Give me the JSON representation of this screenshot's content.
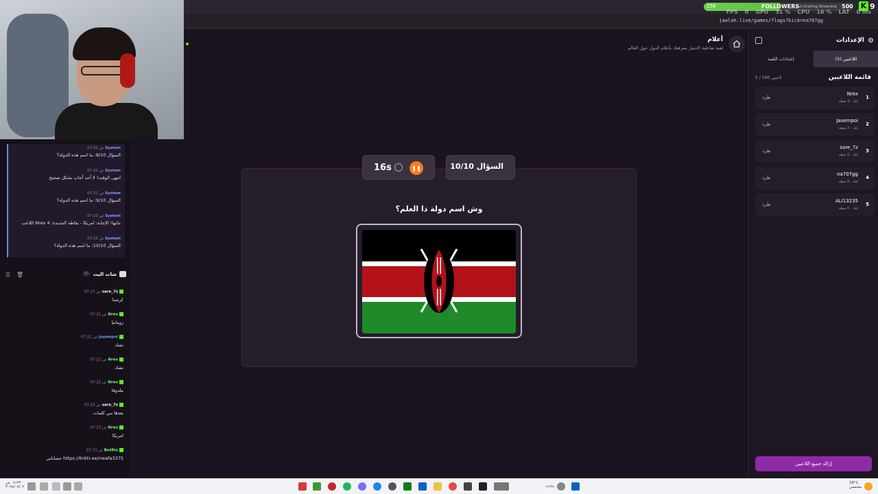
{
  "overlay": {
    "fps_label": "FPS",
    "fps_value": "0",
    "gpu_label": "GPU",
    "gpu_value": "31 %",
    "cpu_label": "CPU",
    "cpu_value": "16 %",
    "lat_label": "LAT",
    "lat_value": "0 ms",
    "followers_label": "FOLLOWERS",
    "followers_sub": "Just Chatting Streaming",
    "followers_start": "256",
    "followers_goal": "500",
    "followers_progress": 0.51,
    "kick_count": "9",
    "kick_logo_text": "K"
  },
  "browser": {
    "url": "jawlah.live/games/flags?kick=na707gg"
  },
  "system_messages": [
    {
      "sender": "System",
      "time": "07:22 ص",
      "text": "السؤال 8/10: ما اسم هذه الدولة؟"
    },
    {
      "sender": "System",
      "time": "07:22 ص",
      "text": "انتهى الوقت! لا أحد أجاب بشكل صحيح"
    },
    {
      "sender": "System",
      "time": "07:22 ص",
      "text": "السؤال 9/10: ما اسم هذه الدولة؟"
    },
    {
      "sender": "System",
      "time": "07:23 ص",
      "text": "اللاعب Nrex جابها! الإجابة: امريكا - نقاطه الجديدة: 4"
    },
    {
      "sender": "System",
      "time": "07:23 ص",
      "text": "السؤال 10/10: ما اسم هذه الدولة؟"
    }
  ],
  "stream_chat": {
    "title": "شات البث",
    "count": "81",
    "messages": [
      {
        "user": "sare_7z",
        "time": "07:21 ص",
        "text": "كرشنا",
        "color": "#ffffff"
      },
      {
        "user": "Nrex",
        "time": "07:21 ص",
        "text": "رومانيا",
        "color": "#7cff7c"
      },
      {
        "user": "Jasempoi",
        "time": "07:21 ص",
        "text": "تشاد",
        "color": "#6ea6ff"
      },
      {
        "user": "Nrex",
        "time": "07:22 ص",
        "text": "تشاد",
        "color": "#7cff7c"
      },
      {
        "user": "Nrex",
        "time": "07:22 ص",
        "text": "ملدوفا",
        "color": "#7cff7c"
      },
      {
        "user": "sare_7z",
        "time": "07:23 ص",
        "text": "بعدها نبي كلمات",
        "color": "#ffffff"
      },
      {
        "user": "Nrex",
        "time": "07:23 ص",
        "text": "امريكا",
        "color": "#7cff7c"
      },
      {
        "user": "BotRix",
        "time": "07:23 ص",
        "text": "حساباتي https://linktr.ee/nwafa3375",
        "color": "#7cff7c"
      }
    ]
  },
  "game": {
    "title": "أعلام",
    "description": "لعبة تفاعلية لاختبار معرفتك بأعلام الدول حول العالم",
    "timer": "16s",
    "question_number": "السؤال 10/10",
    "question": "وش اسم دولة ذا العلم؟",
    "flag_icon": "kenya-flag"
  },
  "sidebar": {
    "title": "الإعدادات",
    "tabs": [
      {
        "label": "اللاعبين (5)",
        "active": true
      },
      {
        "label": "إعدادات اللعبة",
        "active": false
      }
    ],
    "list_title": "قائمة اللاعبين",
    "list_count": "5 / 100 لاعبين",
    "players": [
      {
        "rank": "1",
        "name": "Nrex",
        "meta": "كيك · 4 نقطة",
        "kick": "طرد"
      },
      {
        "rank": "2",
        "name": "Jasempoi",
        "meta": "كيك · 2 نقطة",
        "kick": "طرد"
      },
      {
        "rank": "3",
        "name": "sare_7z",
        "meta": "كيك · 0 نقطة",
        "kick": "طرد"
      },
      {
        "rank": "4",
        "name": "na707gg",
        "meta": "كيك · 0 نقطة",
        "kick": "طرد"
      },
      {
        "rank": "5",
        "name": "ALI13235",
        "meta": "كيك · 0 نقطة",
        "kick": "طرد"
      }
    ],
    "remove_all": "إزالة جميع اللاعبين"
  },
  "taskbar": {
    "time": "٠٧:٢٣ ص",
    "date": "٢٠٢٥/٠٧/٠٢",
    "search": "بحث",
    "weather_temp": "18°C",
    "weather_desc": "مشمس"
  }
}
